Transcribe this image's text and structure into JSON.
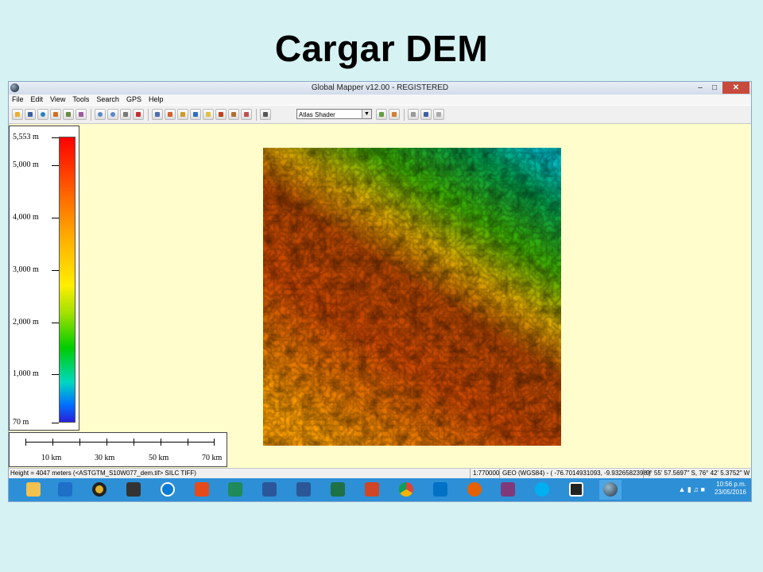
{
  "slide": {
    "title": "Cargar DEM"
  },
  "window": {
    "title": "Global Mapper v12.00 - REGISTERED",
    "controls": {
      "minimize": "–",
      "maximize": "□",
      "close": "✕"
    }
  },
  "menu": [
    "File",
    "Edit",
    "View",
    "Tools",
    "Search",
    "GPS",
    "Help"
  ],
  "toolbar": {
    "shader_value": "Atlas Shader",
    "icons": [
      "open-folder",
      "save",
      "globe",
      "copy",
      "layers",
      "tools",
      "zoom-in",
      "zoom-out",
      "pan",
      "home",
      "digitizer",
      "measure",
      "feature-info",
      "path-profile",
      "view-shed",
      "3d-view",
      "raster-calc",
      "grid",
      "shader-settings",
      "palette",
      "gps-start",
      "gps-track",
      "gps-stop"
    ]
  },
  "legend": {
    "labels": [
      "5,553 m",
      "5,000 m",
      "4,000 m",
      "3,000 m",
      "2,000 m",
      "1,000 m",
      "70 m"
    ]
  },
  "scale_bar": {
    "labels": [
      "10 km",
      "30 km",
      "50 km",
      "70 km"
    ]
  },
  "status": {
    "info": "Height = 4047 meters (<ASTGTM_S10W077_dem.tif> SILC TIFF)",
    "scale": "1:770000",
    "projection": "GEO (WGS84) - ( -76.7014931093, -9.9326582398 )",
    "dms": "9° 55' 57.5697\" S, 76° 42' 5.3752\" W"
  },
  "taskbar": {
    "apps": [
      "file-explorer",
      "launcher",
      "media-player",
      "photos",
      "hp",
      "office",
      "publisher",
      "visio",
      "word",
      "excel",
      "powerpoint",
      "chrome",
      "outlook",
      "firefox",
      "onenote",
      "skype",
      "7zip",
      "global-mapper"
    ],
    "time": "10:56 p.m.",
    "date": "23/05/2016"
  },
  "colors": {
    "map_background": "#fffdcc",
    "taskbar": "#2d8fd6",
    "title_bar": "#d8e2ee"
  }
}
